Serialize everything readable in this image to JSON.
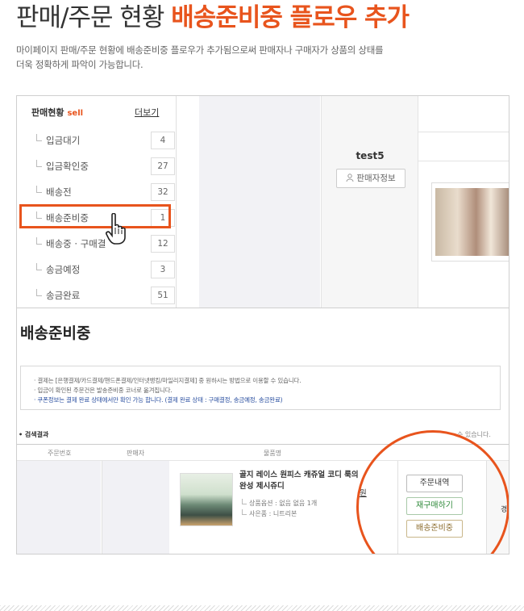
{
  "header": {
    "title_plain": "판매/주문 현황 ",
    "title_accent": "배송준비중 플로우 추가",
    "desc_line1": "마이페이지 판매/주문 현황에 배송준비중 플로우가 추가됨으로써 판매자나 구매자가 상품의 상태를",
    "desc_line2": "더욱 정확하게 파악이 가능합니다."
  },
  "sidebar": {
    "heading": "판매현황",
    "heading_tag": "sell",
    "more_label": "더보기",
    "items": [
      {
        "label": "입금대기",
        "count": "4"
      },
      {
        "label": "입금확인중",
        "count": "27"
      },
      {
        "label": "배송전",
        "count": "32"
      },
      {
        "label": "배송준비중",
        "count": "1"
      },
      {
        "label": "배송중 · 구매결",
        "count": "12"
      },
      {
        "label": "송금예정",
        "count": "3"
      },
      {
        "label": "송금완료",
        "count": "51"
      }
    ],
    "highlighted_index": 3
  },
  "seller": {
    "name": "test5",
    "info_button": "판매자정보"
  },
  "section": {
    "title": "배송준비중",
    "notice_lines": [
      "· 결제는 [은행결제/카드결제/핸드폰결제/인터넷뱅킹/마일리지결제] 중 원하시는 방법으로 이용할 수 있습니다.",
      "· 입금이 확인된 주문건은 발송준비중 코너로 옮겨집니다.",
      "· 쿠폰정보는 결제 완료 상태에서만 확인 가능 합니다. (결제 완료 상태 : 구매결정, 송금예정, 송금완료)"
    ],
    "results_label": "• 검색결과",
    "results_right": "수 있습니다.",
    "columns": [
      "주문번호",
      "판매자",
      "물품명"
    ],
    "product": {
      "name": "골지 레이스 원피스 캐쥬얼 코디 룩의 완성 제시쥬디",
      "name_trunc": "원",
      "option": "상품옵션 : 없음 없음 1개",
      "gift": "사은품 : 니트리본"
    },
    "actions": {
      "order_detail": "주문내역",
      "rebuy": "재구매하기",
      "preparing": "배송준비중"
    },
    "right_stub": "경"
  },
  "colors": {
    "accent": "#e8541d",
    "rebuy_text": "#2f8a3a",
    "preparing_text": "#8a6a2a"
  }
}
